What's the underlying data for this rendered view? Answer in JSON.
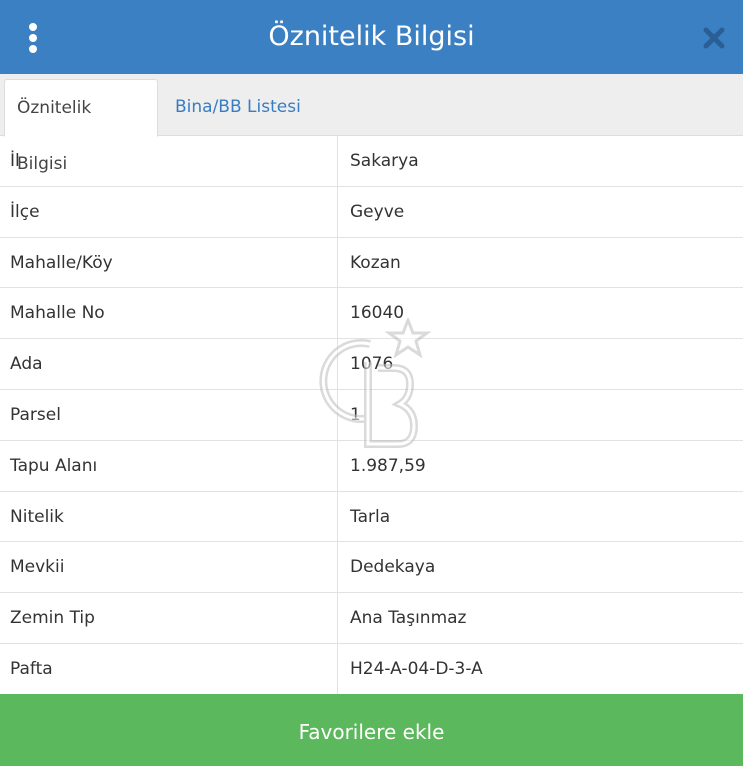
{
  "header": {
    "title": "Öznitelik Bilgisi",
    "menu_icon": "vertical-dots-icon",
    "close_icon": "close-icon",
    "background_color": "#3b80c3"
  },
  "tabs": [
    {
      "label": "Öznitelik Bilgisi",
      "active": true
    },
    {
      "label": "Bina/BB Listesi",
      "active": false
    }
  ],
  "attributes": [
    {
      "label": "İl",
      "value": "Sakarya"
    },
    {
      "label": "İlçe",
      "value": "Geyve"
    },
    {
      "label": "Mahalle/Köy",
      "value": "Kozan"
    },
    {
      "label": "Mahalle No",
      "value": "16040"
    },
    {
      "label": "Ada",
      "value": "1076"
    },
    {
      "label": "Parsel",
      "value": "1"
    },
    {
      "label": "Tapu Alanı",
      "value": "1.987,59"
    },
    {
      "label": "Nitelik",
      "value": "Tarla"
    },
    {
      "label": "Mevkii",
      "value": "Dedekaya"
    },
    {
      "label": "Zemin Tip",
      "value": "Ana Taşınmaz"
    },
    {
      "label": "Pafta",
      "value": "H24-A-04-D-3-A"
    }
  ],
  "watermark_icon": "cb-logo-watermark",
  "footer": {
    "button_label": "Favorilere ekle",
    "button_color": "#5cb85c"
  }
}
